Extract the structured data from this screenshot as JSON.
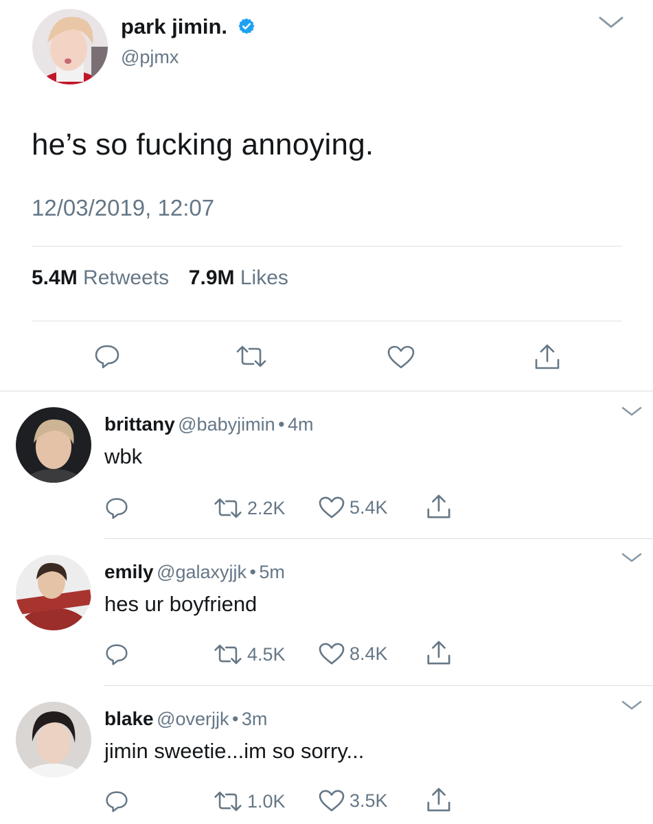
{
  "tweet": {
    "author_name": "park jimin.",
    "author_handle": "@pjmx",
    "text": "he’s so fucking annoying.",
    "timestamp": "12/03/2019, 12:07",
    "retweets_count": "5.4M",
    "retweets_label": "Retweets",
    "likes_count": "7.9M",
    "likes_label": "Likes"
  },
  "replies": [
    {
      "name": "brittany",
      "handle": "@babyjimin",
      "separator": "•",
      "time": "4m",
      "text": "wbk",
      "retweets": "2.2K",
      "likes": "5.4K"
    },
    {
      "name": "emily",
      "handle": "@galaxyjjk",
      "separator": "•",
      "time": "5m",
      "text": "hes ur boyfriend",
      "retweets": "4.5K",
      "likes": "8.4K"
    },
    {
      "name": "blake",
      "handle": "@overjjk",
      "separator": "•",
      "time": "3m",
      "text": "jimin sweetie...im so sorry...",
      "retweets": "1.0K",
      "likes": "3.5K"
    }
  ],
  "colors": {
    "text": "#14171a",
    "secondary": "#657786",
    "verified_blue": "#1da1f2",
    "divider": "#dadee2"
  },
  "icons": [
    "reply-icon",
    "retweet-icon",
    "like-icon",
    "share-icon",
    "chevron-down-icon",
    "verified-badge-icon"
  ]
}
